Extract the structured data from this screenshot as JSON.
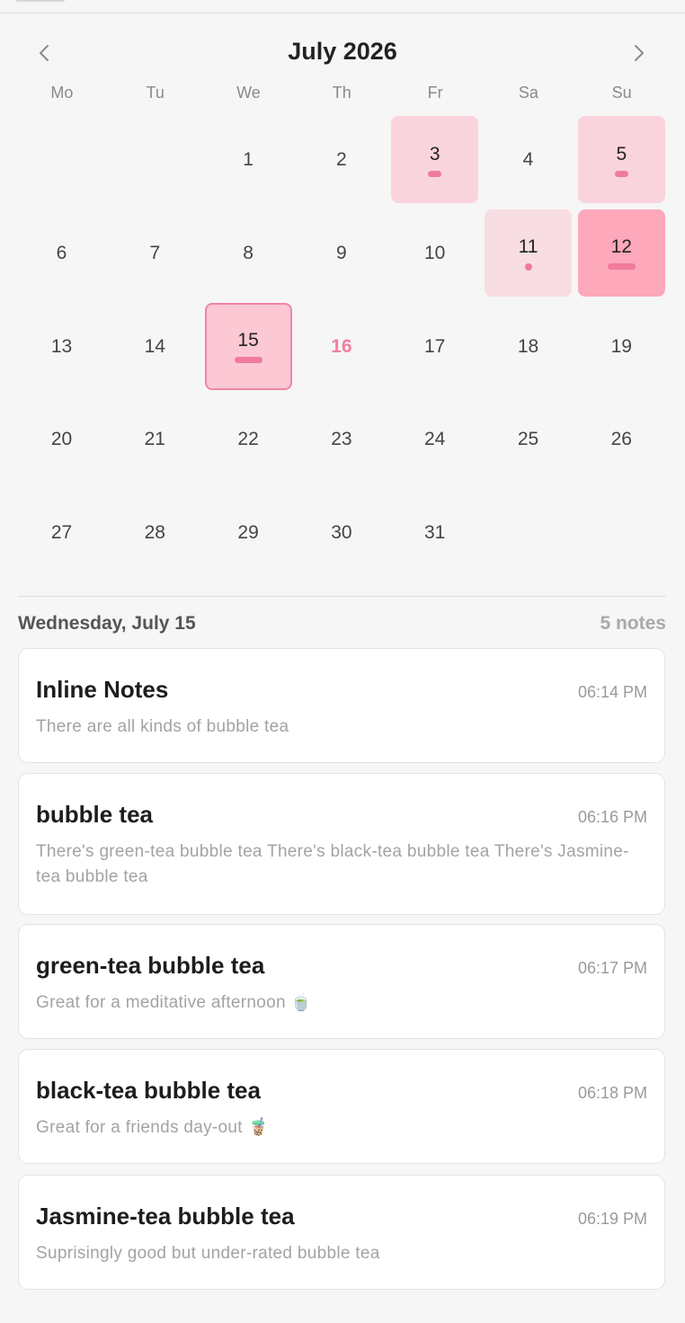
{
  "calendar": {
    "title": "July 2026",
    "weekdays": [
      "Mo",
      "Tu",
      "We",
      "Th",
      "Fr",
      "Sa",
      "Su"
    ],
    "days": [
      {
        "n": "1"
      },
      {
        "n": "2"
      },
      {
        "n": "3",
        "level": "l1",
        "mark": "bar"
      },
      {
        "n": "4"
      },
      {
        "n": "5",
        "level": "l1",
        "mark": "bar"
      },
      {
        "n": "6"
      },
      {
        "n": "7"
      },
      {
        "n": "8"
      },
      {
        "n": "9"
      },
      {
        "n": "10"
      },
      {
        "n": "11",
        "level": "l0",
        "mark": "dot"
      },
      {
        "n": "12",
        "level": "l2",
        "mark": "wide"
      },
      {
        "n": "13"
      },
      {
        "n": "14"
      },
      {
        "n": "15",
        "level": "selected",
        "mark": "wide"
      },
      {
        "n": "16",
        "today": true
      },
      {
        "n": "17"
      },
      {
        "n": "18"
      },
      {
        "n": "19"
      },
      {
        "n": "20"
      },
      {
        "n": "21"
      },
      {
        "n": "22"
      },
      {
        "n": "23"
      },
      {
        "n": "24"
      },
      {
        "n": "25"
      },
      {
        "n": "26"
      },
      {
        "n": "27"
      },
      {
        "n": "28"
      },
      {
        "n": "29"
      },
      {
        "n": "30"
      },
      {
        "n": "31"
      }
    ]
  },
  "list": {
    "date_label": "Wednesday, July 15",
    "count_label": "5 notes"
  },
  "notes": [
    {
      "title": "Inline Notes",
      "time": "06:14 PM",
      "body": "There are all kinds of bubble tea"
    },
    {
      "title": "bubble tea",
      "time": "06:16 PM",
      "body": "There's green-tea bubble tea There's black-tea bubble tea There's Jasmine-tea bubble tea"
    },
    {
      "title": "green-tea bubble tea",
      "time": "06:17 PM",
      "body": "Great for a meditative afternoon 🍵"
    },
    {
      "title": "black-tea bubble tea",
      "time": "06:18 PM",
      "body": "Great for a friends day-out 🧋"
    },
    {
      "title": "Jasmine-tea bubble tea",
      "time": "06:19 PM",
      "body": "Suprisingly good but under-rated bubble tea"
    }
  ],
  "colors": {
    "accent": "#f27f9f",
    "background": "#f6f6f6"
  }
}
